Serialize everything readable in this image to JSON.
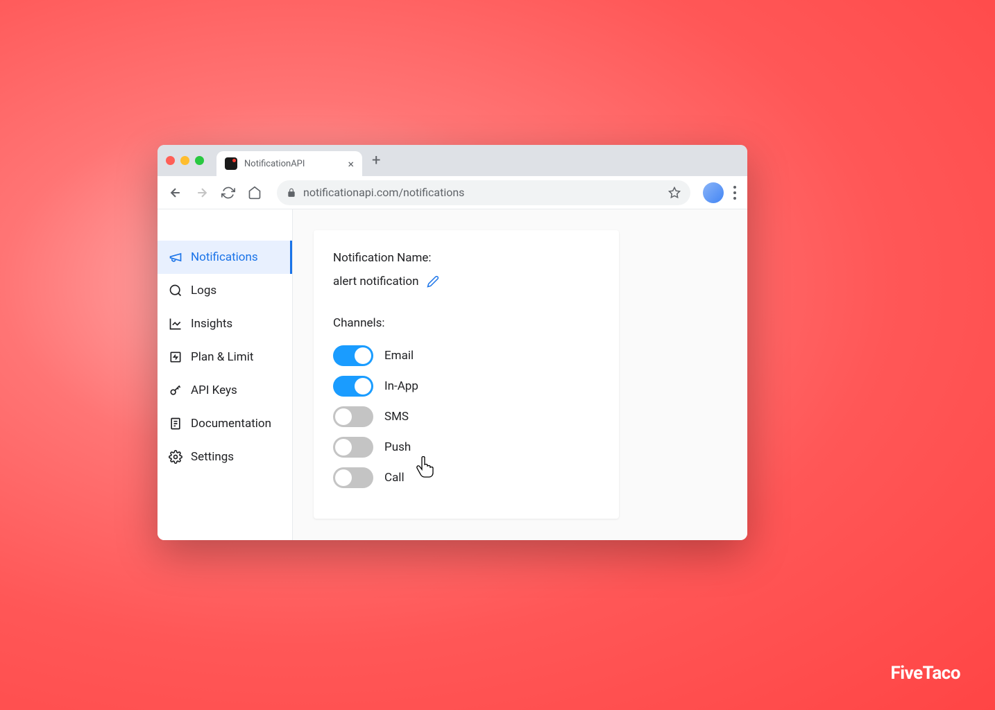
{
  "browser": {
    "tab_title": "NotificationAPI",
    "url": "notificationapi.com/notifications"
  },
  "sidebar": {
    "items": [
      {
        "label": "Notifications",
        "active": true
      },
      {
        "label": "Logs",
        "active": false
      },
      {
        "label": "Insights",
        "active": false
      },
      {
        "label": "Plan & Limit",
        "active": false
      },
      {
        "label": "API Keys",
        "active": false
      },
      {
        "label": "Documentation",
        "active": false
      },
      {
        "label": "Settings",
        "active": false
      }
    ]
  },
  "main": {
    "name_label": "Notification Name:",
    "name_value": "alert notification",
    "channels_label": "Channels:",
    "channels": [
      {
        "label": "Email",
        "on": true
      },
      {
        "label": "In-App",
        "on": true
      },
      {
        "label": "SMS",
        "on": false
      },
      {
        "label": "Push",
        "on": false
      },
      {
        "label": "Call",
        "on": false
      }
    ]
  },
  "watermark": "FiveTaco"
}
